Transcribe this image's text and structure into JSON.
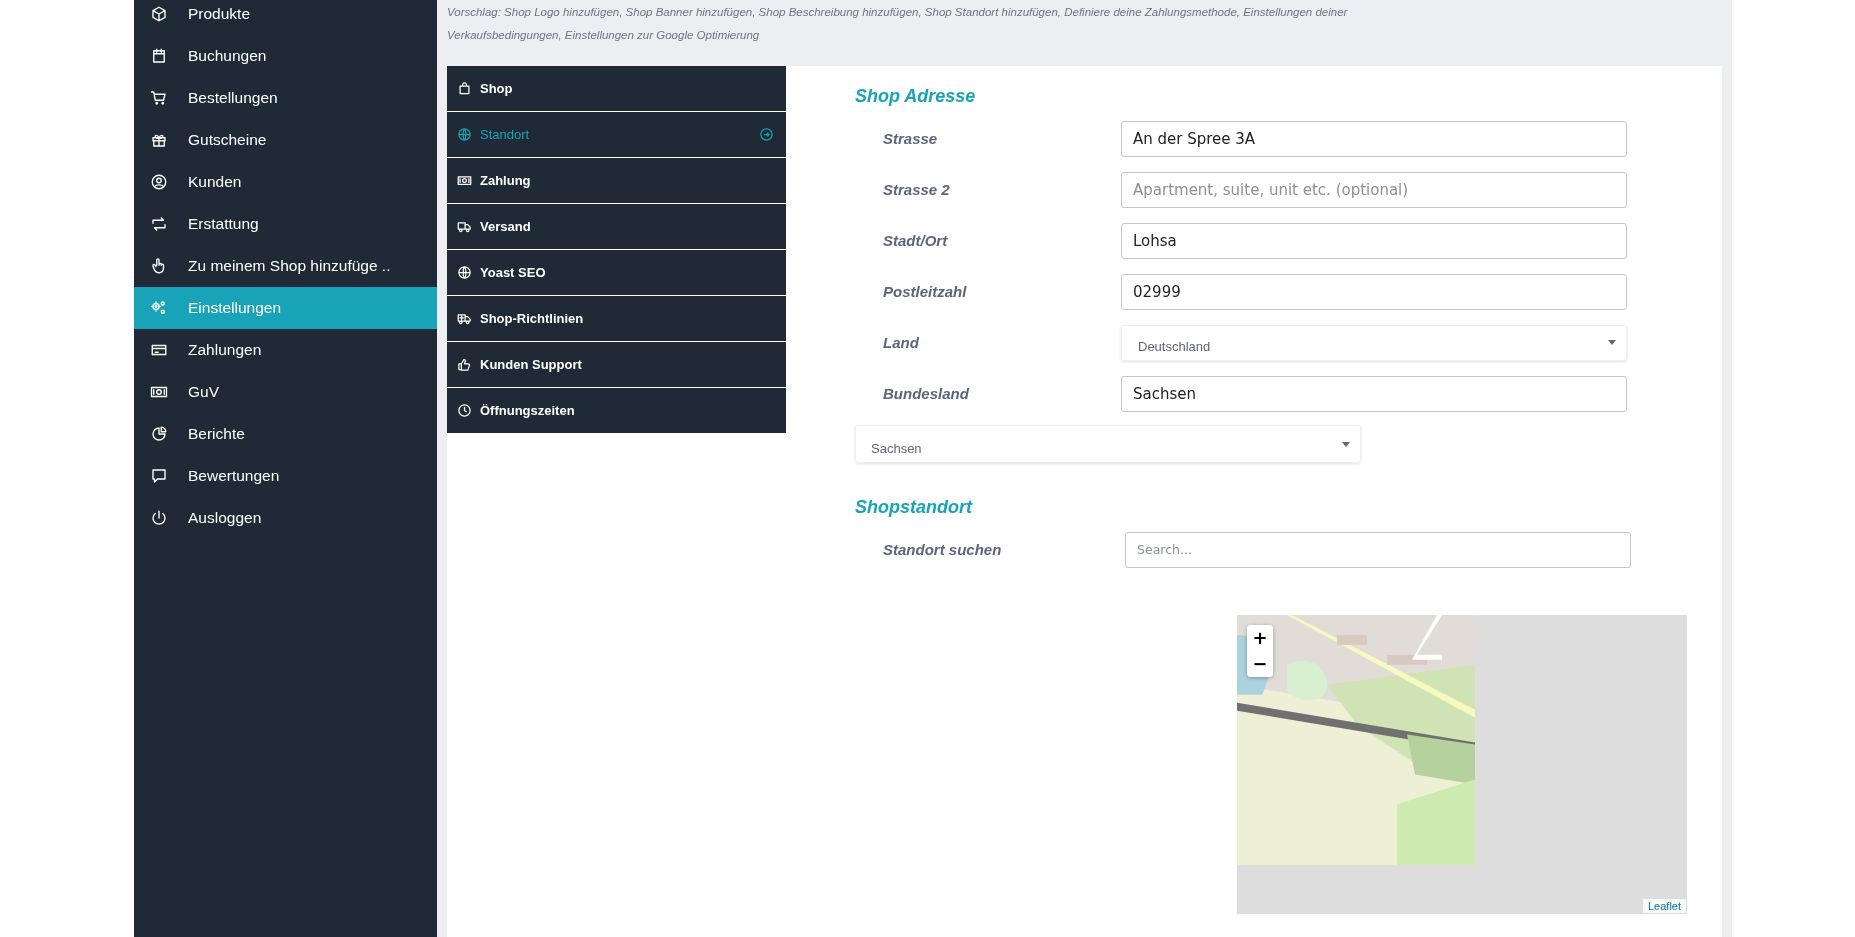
{
  "sidebar": {
    "items": [
      {
        "label": "Produkte",
        "selected": false
      },
      {
        "label": "Buchungen",
        "selected": false
      },
      {
        "label": "Bestellungen",
        "selected": false
      },
      {
        "label": "Gutscheine",
        "selected": false
      },
      {
        "label": "Kunden",
        "selected": false
      },
      {
        "label": "Erstattung",
        "selected": false
      },
      {
        "label": "Zu meinem Shop hinzufüge ..",
        "selected": false
      },
      {
        "label": "Einstellungen",
        "selected": true
      },
      {
        "label": "Zahlungen",
        "selected": false
      },
      {
        "label": "GuV",
        "selected": false
      },
      {
        "label": "Berichte",
        "selected": false
      },
      {
        "label": "Bewertungen",
        "selected": false
      },
      {
        "label": "Ausloggen",
        "selected": false
      }
    ]
  },
  "suggestion": "Vorschlag: Shop Logo hinzufügen, Shop Banner hinzufügen, Shop Beschreibung hinzufügen, Shop Standort hinzufügen, Definiere deine Zahlungsmethode, Einstellungen deiner Verkaufsbedingungen, Einstellungen zur Google Optimierung",
  "settings_menu": [
    {
      "label": "Shop",
      "selected": false
    },
    {
      "label": "Standort",
      "selected": true
    },
    {
      "label": "Zahlung",
      "selected": false
    },
    {
      "label": "Versand",
      "selected": false
    },
    {
      "label": "Yoast SEO",
      "selected": false
    },
    {
      "label": "Shop-Richtlinien",
      "selected": false
    },
    {
      "label": "Kunden Support",
      "selected": false
    },
    {
      "label": "Öffnungszeiten",
      "selected": false
    }
  ],
  "address": {
    "heading": "Shop Adresse",
    "fields": [
      {
        "kind": "input",
        "label": "Strasse",
        "value": "An der Spree 3A"
      },
      {
        "kind": "input",
        "label": "Strasse 2",
        "placeholder": "Apartment, suite, unit etc. (optional)"
      },
      {
        "kind": "input",
        "label": "Stadt/Ort",
        "value": "Lohsa"
      },
      {
        "kind": "input",
        "label": "Postleitzahl",
        "value": "02999"
      },
      {
        "kind": "select",
        "label": "Land",
        "value": "Deutschland"
      },
      {
        "kind": "input",
        "label": "Bundesland",
        "value": "Sachsen"
      },
      {
        "kind": "select",
        "value": "Sachsen"
      }
    ]
  },
  "location": {
    "heading": "Shopstandort",
    "search_label": "Standort suchen",
    "search_placeholder": "Search...",
    "map": {
      "kind": "picture",
      "zoom_in": "+",
      "zoom_out": "−",
      "attribution": "Leaflet"
    }
  }
}
